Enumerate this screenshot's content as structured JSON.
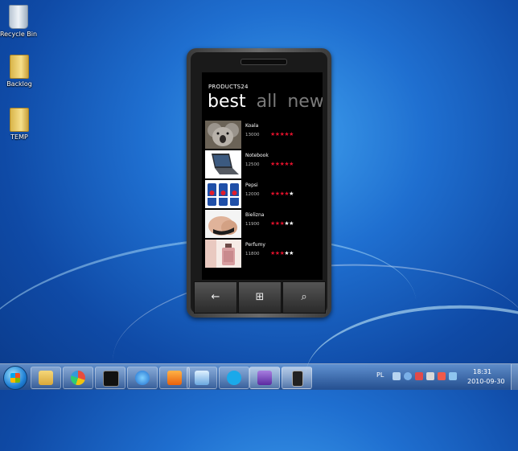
{
  "desktop": {
    "icons": [
      {
        "label": "Recycle Bin",
        "icon": "recycle-bin-icon"
      },
      {
        "label": "Backlog",
        "icon": "folder-icon"
      },
      {
        "label": "TEMP",
        "icon": "folder-icon"
      }
    ]
  },
  "phone": {
    "app_title": "PRODUCTS24",
    "pivot": [
      {
        "label": "best",
        "active": true
      },
      {
        "label": "all",
        "active": false
      },
      {
        "label": "new",
        "active": false
      }
    ],
    "products": [
      {
        "name": "Koala",
        "price": "13000",
        "rating": 5,
        "thumb": "koala-image"
      },
      {
        "name": "Notebook",
        "price": "12500",
        "rating": 5,
        "thumb": "notebook-image"
      },
      {
        "name": "Pepsi",
        "price": "12000",
        "rating": 4,
        "thumb": "pepsi-image"
      },
      {
        "name": "Bielizna",
        "price": "11900",
        "rating": 3,
        "thumb": "lingerie-image"
      },
      {
        "name": "Perfumy",
        "price": "11800",
        "rating": 3,
        "thumb": "perfume-image"
      }
    ],
    "rating_max": 5,
    "buttons": {
      "back": "←",
      "start": "⊞",
      "search": "⌕"
    }
  },
  "taskbar": {
    "language": "PL",
    "time": "18:31",
    "date": "2010-09-30"
  },
  "colors": {
    "star_on": "#e0112b",
    "star_off": "#ffffff",
    "pivot_inactive": "#7a7a7a"
  }
}
